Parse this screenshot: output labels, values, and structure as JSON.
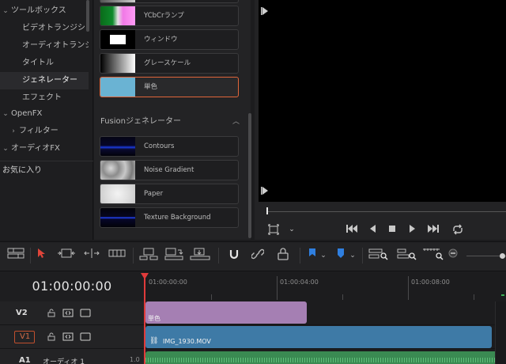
{
  "sidebar": {
    "items": [
      {
        "label": "ツールボックス",
        "chevron": "⌄",
        "indent": 0
      },
      {
        "label": "ビデオトランジション",
        "indent": 1
      },
      {
        "label": "オーディオトランジション",
        "indent": 1
      },
      {
        "label": "タイトル",
        "indent": 1
      },
      {
        "label": "ジェネレーター",
        "indent": 1,
        "selected": true
      },
      {
        "label": "エフェクト",
        "indent": 1
      },
      {
        "label": "OpenFX",
        "chevron": "⌄",
        "indent": 0
      },
      {
        "label": "フィルター",
        "chevron": "›",
        "indent": 1
      },
      {
        "label": "オーディオFX",
        "chevron": "⌄",
        "indent": 0
      }
    ],
    "favorites_label": "お気に入り"
  },
  "generators": {
    "items": [
      {
        "label": "YCbCrランプ",
        "thumb": "ycbcr"
      },
      {
        "label": "ウィンドウ",
        "thumb": "window"
      },
      {
        "label": "グレースケール",
        "thumb": "gray"
      },
      {
        "label": "単色",
        "thumb": "solid",
        "selected": true
      }
    ],
    "fusion_header": "Fusionジェネレーター",
    "fusion_items": [
      {
        "label": "Contours",
        "thumb": "contours"
      },
      {
        "label": "Noise Gradient",
        "thumb": "noise"
      },
      {
        "label": "Paper",
        "thumb": "paper"
      },
      {
        "label": "Texture Background",
        "thumb": "texture"
      }
    ]
  },
  "timeline": {
    "timecode": "01:00:00:00",
    "ruler_ticks": [
      "01:00:00:00",
      "01:00:04:00",
      "01:00:08:00"
    ],
    "tracks": [
      {
        "name": "V2"
      },
      {
        "name": "V1"
      },
      {
        "name": "A1",
        "label": "オーディオ 1",
        "level": "1.0"
      }
    ],
    "clips": {
      "v2": "単色",
      "v1": "IMG_1930.MOV"
    }
  },
  "colors": {
    "accent_orange": "#e0653a",
    "playhead_red": "#e03b3b",
    "video_clip": "#3e7aa6",
    "solid_clip": "#a57fb3",
    "audio_clip": "#3a8a52",
    "active_blue": "#2f7fe0"
  },
  "icons": {
    "toolbar": [
      "timeline-view-icon",
      "select-arrow-icon",
      "trim-icon",
      "dynamic-trim-icon",
      "blade-icon",
      "insert-icon",
      "overwrite-icon",
      "replace-icon",
      "snap-icon",
      "link-icon",
      "lock-icon",
      "flag-icon",
      "marker-icon",
      "zoom-full-icon",
      "zoom-detail-icon",
      "zoom-custom-icon",
      "zoom-out-icon"
    ],
    "transport": [
      "prev-clip-icon",
      "step-back-icon",
      "stop-icon",
      "play-icon",
      "next-clip-icon",
      "loop-icon"
    ]
  }
}
